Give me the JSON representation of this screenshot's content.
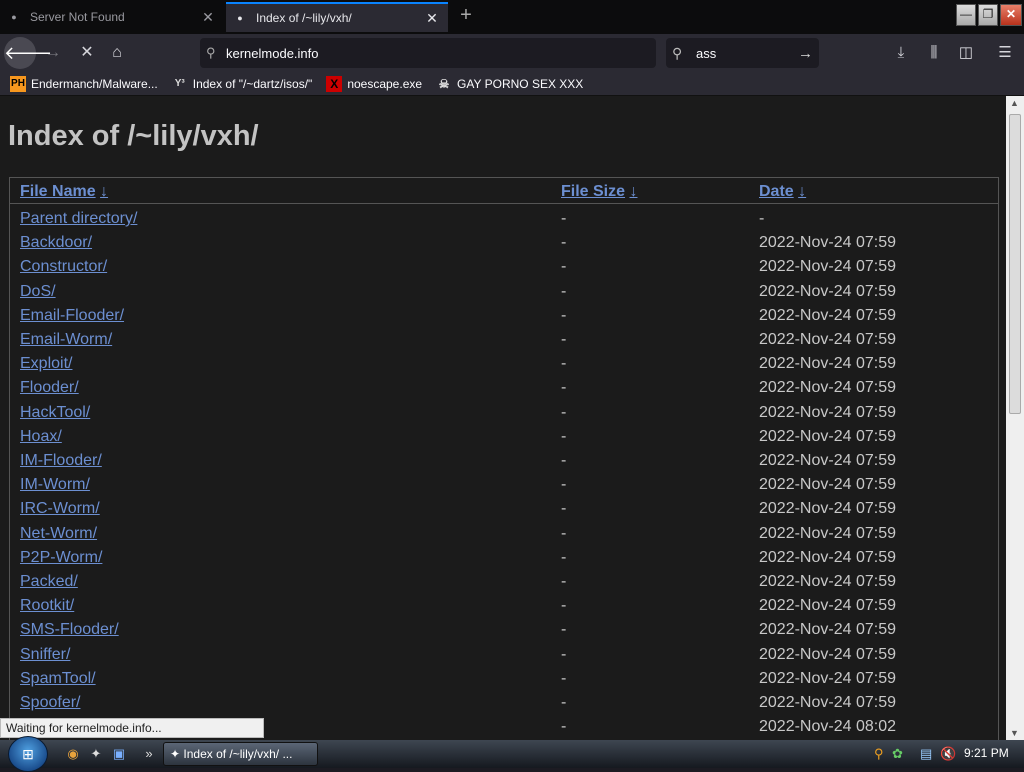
{
  "tabs": [
    {
      "title": "Server Not Found",
      "active": false
    },
    {
      "title": "Index of /~lily/vxh/",
      "active": true
    }
  ],
  "window_controls": {
    "minimize": "—",
    "restore": "❐",
    "close": "✕"
  },
  "nav": {
    "url": "kernelmode.info",
    "search_value": "ass"
  },
  "bookmarks": [
    {
      "icon": "PH",
      "label": "Endermanch/Malware..."
    },
    {
      "icon": "Y³",
      "label": "Index of \"/~dartz/isos/\""
    },
    {
      "icon": "X",
      "label": "noescape.exe"
    },
    {
      "icon": "☠",
      "label": "GAY PORNO SEX XXX"
    }
  ],
  "page": {
    "heading": "Index of /~lily/vxh/",
    "columns": {
      "name": "File Name",
      "size": "File Size",
      "date": "Date",
      "sort_arrow": "↓"
    },
    "rows": [
      {
        "name": "Parent directory/",
        "size": "-",
        "date": "-"
      },
      {
        "name": "Backdoor/",
        "size": "-",
        "date": "2022-Nov-24 07:59"
      },
      {
        "name": "Constructor/",
        "size": "-",
        "date": "2022-Nov-24 07:59"
      },
      {
        "name": "DoS/",
        "size": "-",
        "date": "2022-Nov-24 07:59"
      },
      {
        "name": "Email-Flooder/",
        "size": "-",
        "date": "2022-Nov-24 07:59"
      },
      {
        "name": "Email-Worm/",
        "size": "-",
        "date": "2022-Nov-24 07:59"
      },
      {
        "name": "Exploit/",
        "size": "-",
        "date": "2022-Nov-24 07:59"
      },
      {
        "name": "Flooder/",
        "size": "-",
        "date": "2022-Nov-24 07:59"
      },
      {
        "name": "HackTool/",
        "size": "-",
        "date": "2022-Nov-24 07:59"
      },
      {
        "name": "Hoax/",
        "size": "-",
        "date": "2022-Nov-24 07:59"
      },
      {
        "name": "IM-Flooder/",
        "size": "-",
        "date": "2022-Nov-24 07:59"
      },
      {
        "name": "IM-Worm/",
        "size": "-",
        "date": "2022-Nov-24 07:59"
      },
      {
        "name": "IRC-Worm/",
        "size": "-",
        "date": "2022-Nov-24 07:59"
      },
      {
        "name": "Net-Worm/",
        "size": "-",
        "date": "2022-Nov-24 07:59"
      },
      {
        "name": "P2P-Worm/",
        "size": "-",
        "date": "2022-Nov-24 07:59"
      },
      {
        "name": "Packed/",
        "size": "-",
        "date": "2022-Nov-24 07:59"
      },
      {
        "name": "Rootkit/",
        "size": "-",
        "date": "2022-Nov-24 07:59"
      },
      {
        "name": "SMS-Flooder/",
        "size": "-",
        "date": "2022-Nov-24 07:59"
      },
      {
        "name": "Sniffer/",
        "size": "-",
        "date": "2022-Nov-24 07:59"
      },
      {
        "name": "SpamTool/",
        "size": "-",
        "date": "2022-Nov-24 07:59"
      },
      {
        "name": "Spoofer/",
        "size": "-",
        "date": "2022-Nov-24 07:59"
      },
      {
        "name": "",
        "size": "-",
        "date": "2022-Nov-24 08:02"
      }
    ]
  },
  "status_text": "Waiting for kernelmode.info...",
  "taskbar": {
    "task_label": "Index of /~lily/vxh/ ...",
    "clock": "9:21 PM"
  },
  "colors": {
    "link": "#6c8fd1",
    "background": "#1b1b1b",
    "accent": "#0a84ff"
  }
}
